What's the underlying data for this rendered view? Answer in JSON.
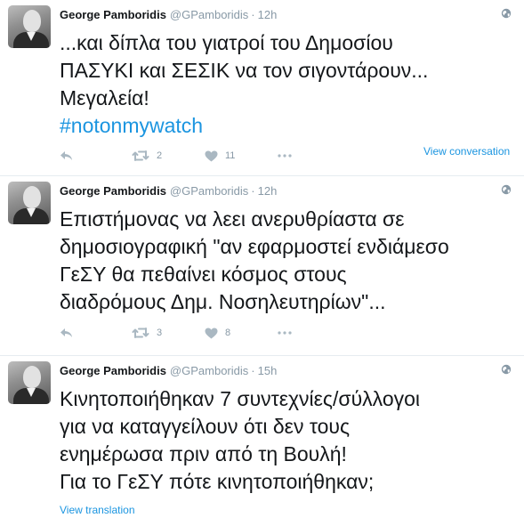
{
  "tweets": [
    {
      "name": "George Pamboridis",
      "handle": "@GPamboridis",
      "dot": "·",
      "time": "12h",
      "lines": [
        "...και δίπλα του γιατροί του Δημοσίου",
        "ΠΑΣΥΚΙ και ΣΕΣΙΚ να τον σιγοντάρουν...",
        "Μεγαλεία!"
      ],
      "hashtag": "#notonmywatch",
      "retweets": "2",
      "likes": "11",
      "link": "View conversation"
    },
    {
      "name": "George Pamboridis",
      "handle": "@GPamboridis",
      "dot": "·",
      "time": "12h",
      "lines": [
        "Επιστήμονας να λεει ανερυθρίαστα σε",
        "δημοσιογραφική \"αν εφαρμοστεί ενδιάμεσο",
        "ΓεΣΥ θα πεθαίνει κόσμος στους",
        "διαδρόμους Δημ. Νοσηλευτηρίων\"..."
      ],
      "retweets": "3",
      "likes": "8"
    },
    {
      "name": "George Pamboridis",
      "handle": "@GPamboridis",
      "dot": "·",
      "time": "15h",
      "lines": [
        "Κινητοποιήθηκαν 7 συντεχνίες/σύλλογοι",
        "για να καταγγείλουν ότι δεν τους",
        "ενημέρωσα πριν από τη Βουλή!",
        "Για το ΓεΣΥ πότε κινητοποιήθηκαν;"
      ],
      "link": "View translation"
    }
  ],
  "icons": {
    "avatar": "profile-photo",
    "globe": "globe-icon",
    "reply": "reply-icon",
    "retweet": "retweet-icon",
    "like": "heart-icon",
    "more": "more-icon"
  },
  "colors": {
    "text": "#14171a",
    "muted": "#8899a6",
    "link": "#1b95e0",
    "separator": "#e6ecf0"
  }
}
